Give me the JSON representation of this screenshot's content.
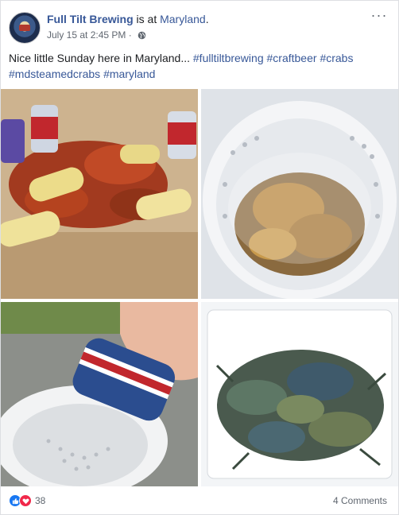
{
  "post": {
    "page_name": "Full Tilt Brewing",
    "is_at": " is at ",
    "place": "Maryland",
    "place_suffix": ".",
    "timestamp": "July 15 at 2:45 PM",
    "separator": " · ",
    "privacy_icon": "globe-icon",
    "more_icon": "more-options-icon",
    "more_label": "···",
    "caption_text": "Nice little Sunday here in Maryland... ",
    "hashtags": [
      "#fulltiltbrewing",
      "#craftbeer",
      "#crabs",
      "#mdsteamedcrabs",
      "#maryland"
    ],
    "photos": [
      {
        "name": "photo-crabs-corn-beer"
      },
      {
        "name": "photo-crabs-in-steamer-pot"
      },
      {
        "name": "photo-can-over-steamer-basket"
      },
      {
        "name": "photo-live-crabs-in-cooler"
      }
    ]
  },
  "footer": {
    "reaction_icons": [
      "like-icon",
      "love-icon"
    ],
    "reaction_count": "38",
    "comments_label": "4 Comments"
  },
  "colors": {
    "link": "#385898",
    "like": "#1877f2",
    "love": "#f0284a",
    "muted": "#606770"
  }
}
